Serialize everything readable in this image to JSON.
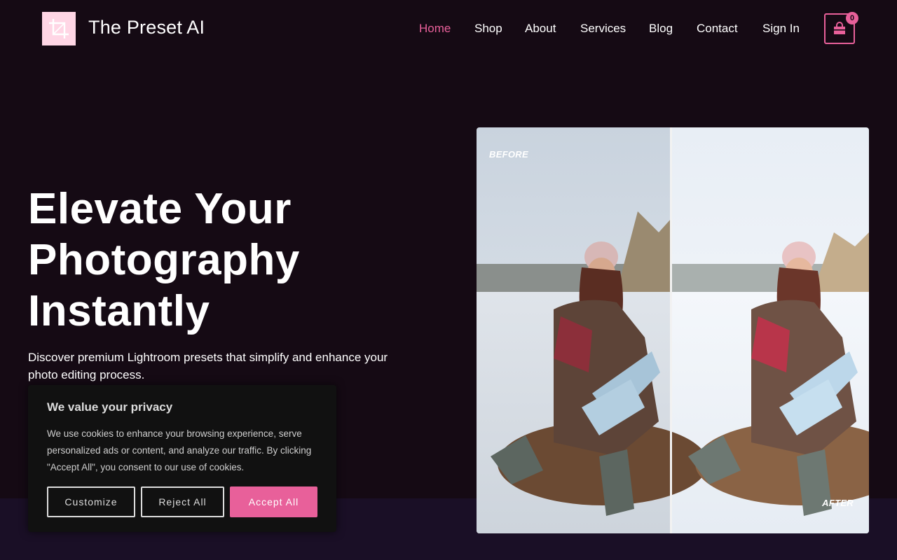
{
  "brand": {
    "name": "The Preset AI",
    "logo_icon": "crop-icon",
    "logo_color": "#ffd6e5"
  },
  "nav": {
    "items": [
      {
        "label": "Home",
        "active": true
      },
      {
        "label": "Shop"
      },
      {
        "label": "About"
      },
      {
        "label": "Services"
      },
      {
        "label": "Blog"
      },
      {
        "label": "Contact"
      },
      {
        "label": "Sign In"
      }
    ],
    "cart": {
      "icon": "shopping-bag-icon",
      "count": "0"
    }
  },
  "hero": {
    "title_lines": [
      "Elevate Your",
      "Photography",
      "Instantly"
    ],
    "subtitle": "Discover premium Lightroom presets that simplify and enhance your photo editing process.",
    "image": {
      "before_label": "BEFORE",
      "after_label": "AFTER"
    }
  },
  "cookie_banner": {
    "title": "We value your privacy",
    "text": "We use cookies to enhance your browsing experience, serve personalized ads or content, and analyze our traffic. By clicking \"Accept All\", you consent to our use of cookies.",
    "buttons": {
      "customize": "Customize",
      "reject": "Reject All",
      "accept": "Accept All"
    }
  },
  "colors": {
    "accent": "#e8609a",
    "background": "#150a14",
    "band": "#1a0f26"
  }
}
